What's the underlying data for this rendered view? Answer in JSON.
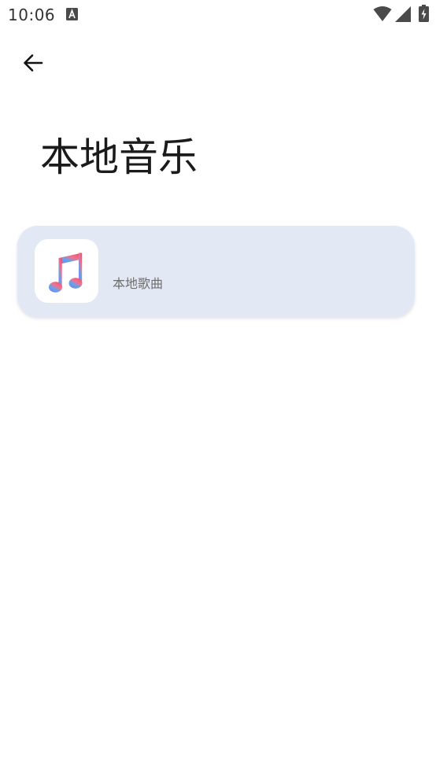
{
  "status_bar": {
    "time": "10:06",
    "notification_icon": "a-letter-notification-icon",
    "wifi_icon": "wifi-icon",
    "signal_icon": "cellular-signal-icon",
    "battery_icon": "battery-charging-icon"
  },
  "header": {
    "back_icon": "arrow-back-icon",
    "title": "本地音乐"
  },
  "items": [
    {
      "icon": "music-note-icon",
      "label": "本地歌曲"
    }
  ],
  "colors": {
    "card_background": "#e2e8f4",
    "music_note_gradient": [
      "#f0506e",
      "#f4718e",
      "#5aa6f0",
      "#9a6fe0"
    ]
  }
}
